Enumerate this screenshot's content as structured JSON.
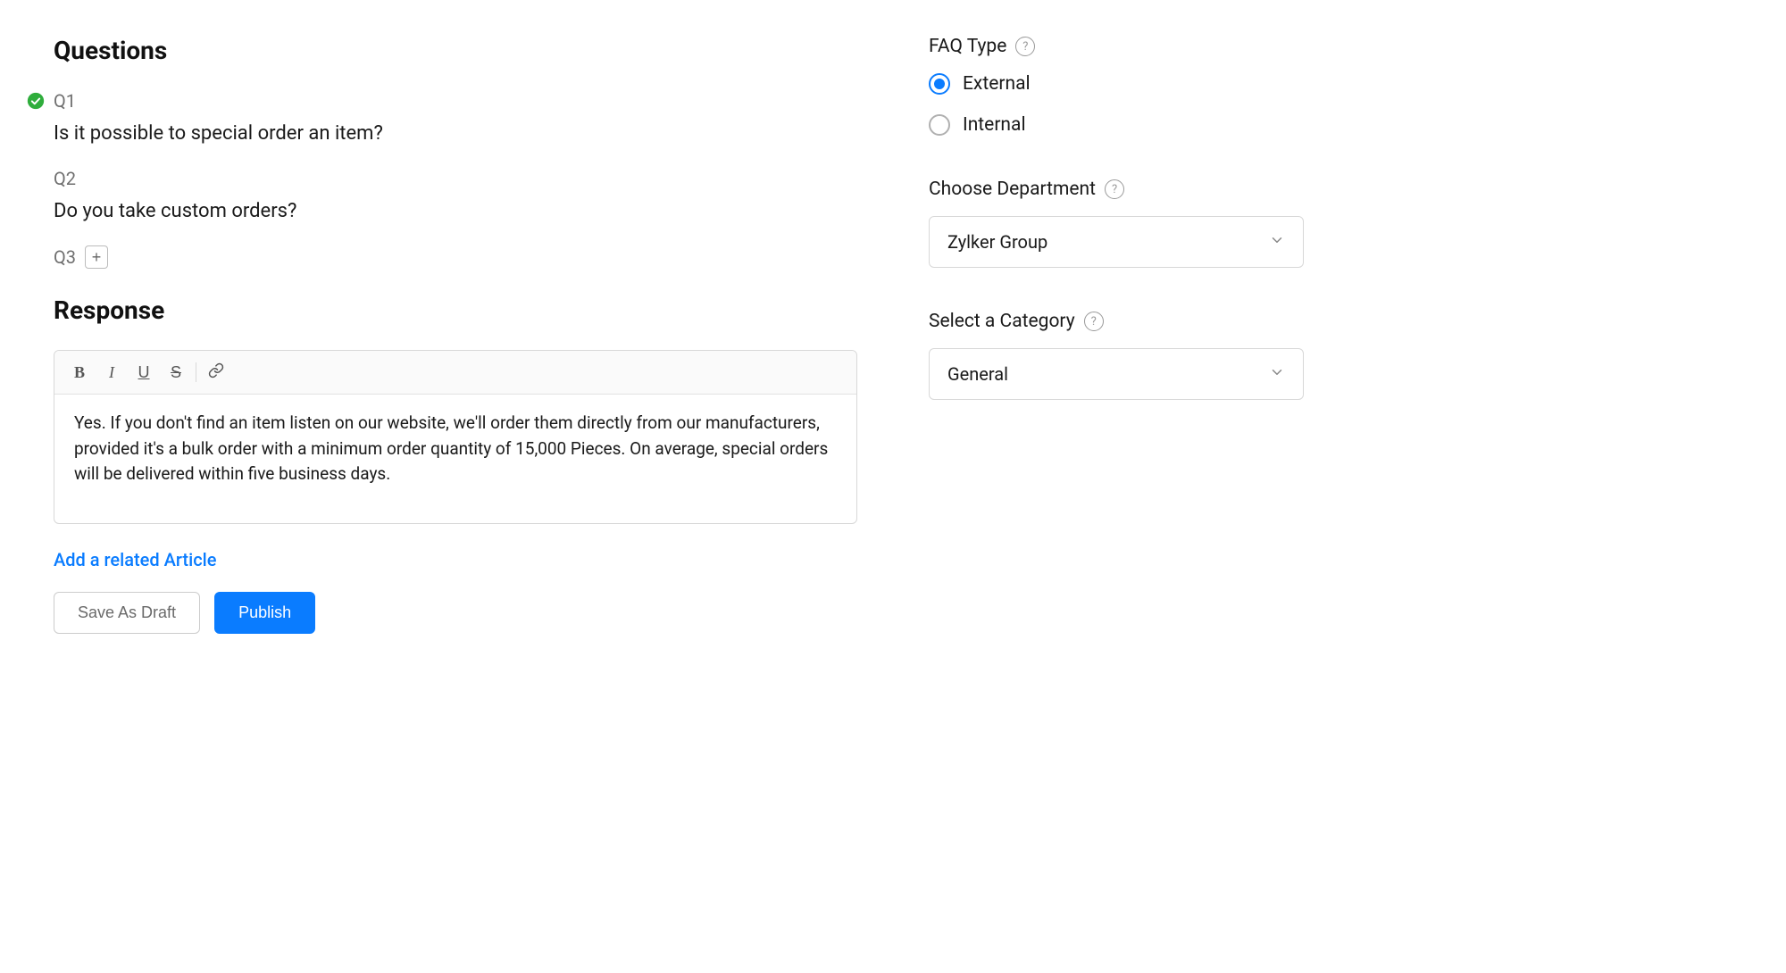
{
  "questions": {
    "title": "Questions",
    "q1_label": "Q1",
    "q1_text": "Is it possible to special order an item?",
    "q2_label": "Q2",
    "q2_text": "Do you take custom orders?",
    "q3_label": "Q3"
  },
  "response": {
    "title": "Response",
    "body": "Yes. If you don't find an item listen on our website, we'll order them directly from our manufacturers, provided it's a bulk order with a minimum order quantity of 15,000 Pieces. On average, special orders will be delivered within five business days."
  },
  "actions": {
    "related_link": "Add a related Article",
    "save_draft": "Save As Draft",
    "publish": "Publish"
  },
  "sidebar": {
    "faq_type_label": "FAQ Type",
    "faq_external": "External",
    "faq_internal": "Internal",
    "department_label": "Choose Department",
    "department_value": "Zylker Group",
    "category_label": "Select a Category",
    "category_value": "General"
  }
}
